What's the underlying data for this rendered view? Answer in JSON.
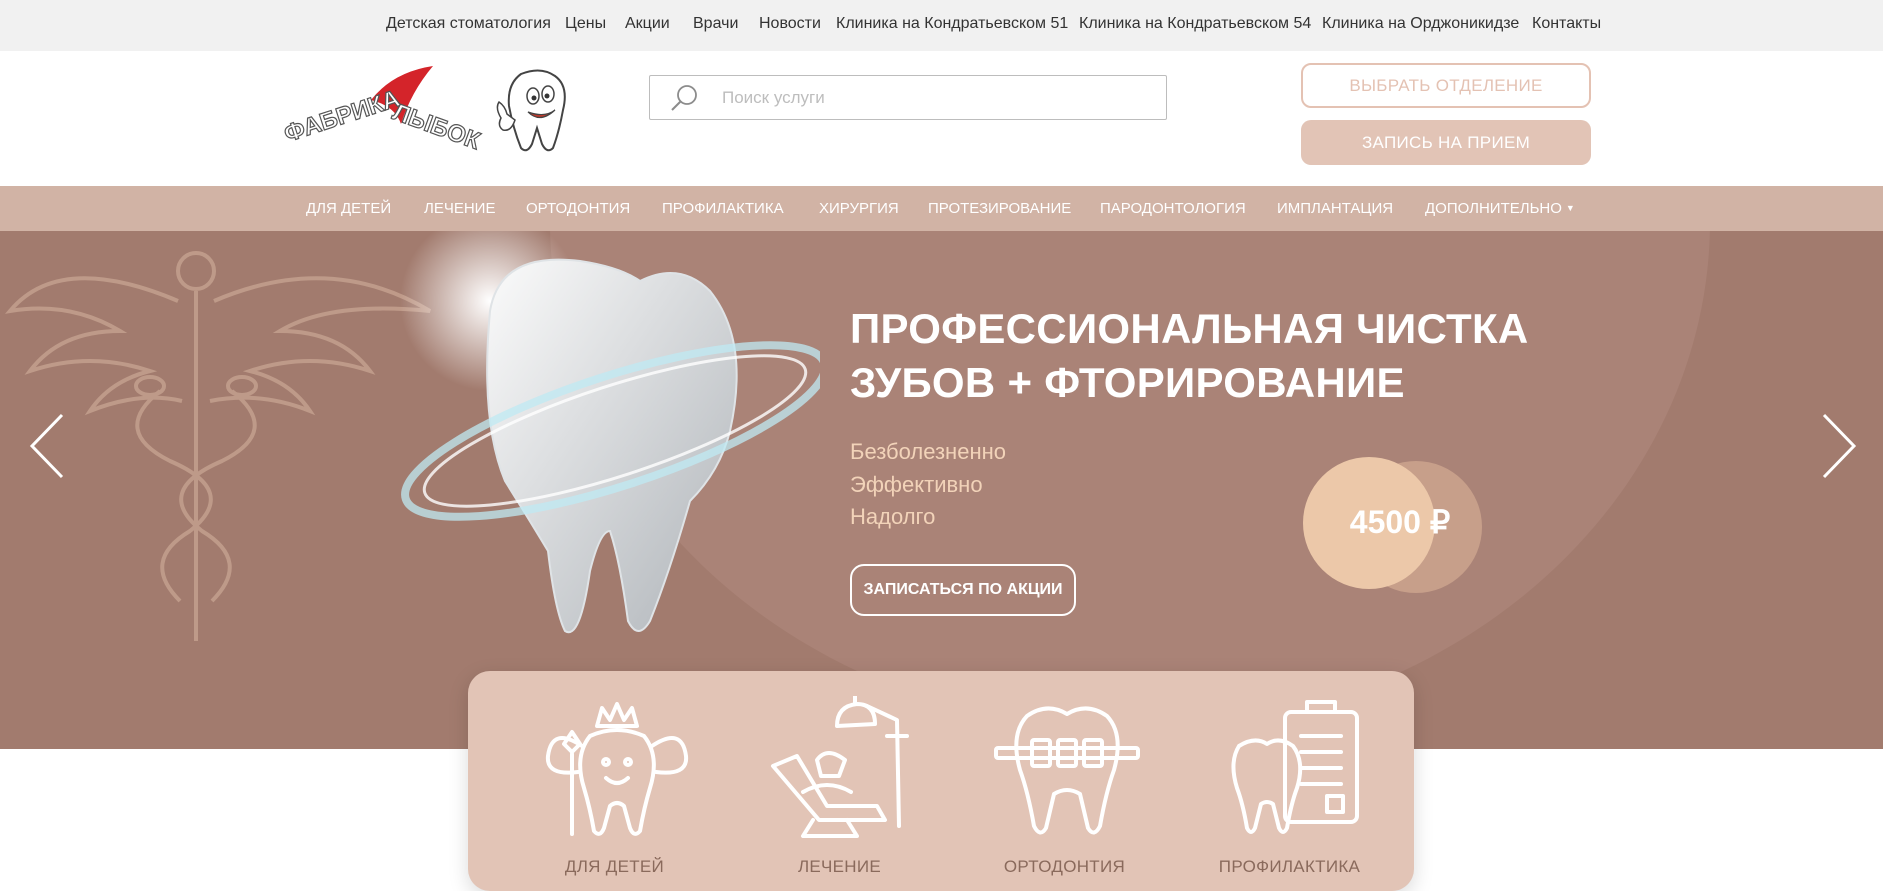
{
  "topnav": {
    "items": [
      {
        "label": "Детская стоматология"
      },
      {
        "label": "Цены"
      },
      {
        "label": "Акции"
      },
      {
        "label": "Врачи"
      },
      {
        "label": "Новости"
      },
      {
        "label": "Клиника на Кондратьевском 51"
      },
      {
        "label": "Клиника на Кондратьевском 54"
      },
      {
        "label": "Клиника на Орджоникидзе"
      },
      {
        "label": "Контакты"
      }
    ]
  },
  "header": {
    "logo": {
      "text_part1": "ФАБРИКА",
      "text_part2": "ЛЫБОК"
    },
    "search": {
      "placeholder": "Поиск услуги",
      "value": ""
    },
    "branch_button": "ВЫБРАТЬ ОТДЕЛЕНИЕ",
    "appointment_button": "ЗАПИСЬ НА ПРИЕМ"
  },
  "mainnav": {
    "items": [
      {
        "label": "ДЛЯ ДЕТЕЙ"
      },
      {
        "label": "ЛЕЧЕНИЕ"
      },
      {
        "label": "ОРТОДОНТИЯ"
      },
      {
        "label": "ПРОФИЛАКТИКА"
      },
      {
        "label": "ХИРУРГИЯ"
      },
      {
        "label": "ПРОТЕЗИРОВАНИЕ"
      },
      {
        "label": "ПАРОДОНТОЛОГИЯ"
      },
      {
        "label": "ИМПЛАНТАЦИЯ"
      },
      {
        "label": "ДОПОЛНИТЕЛЬНО"
      }
    ]
  },
  "hero": {
    "title_line1": "ПРОФЕССИОНАЛЬНАЯ ЧИСТКА",
    "title_line2": "ЗУБОВ + ФТОРИРОВАНИЕ",
    "features": [
      "Безболезненно",
      "Эффективно",
      "Надолго"
    ],
    "cta": "ЗАПИСАТЬСЯ ПО АКЦИИ",
    "price": "4500 ₽",
    "colors": {
      "background": "#a27b6e",
      "accent": "#f2d3b9"
    }
  },
  "services": [
    {
      "label": "ДЛЯ ДЕТЕЙ",
      "icon": "tooth-fairy-icon"
    },
    {
      "label": "ЛЕЧЕНИЕ",
      "icon": "dental-chair-icon"
    },
    {
      "label": "ОРТОДОНТИЯ",
      "icon": "tooth-braces-icon"
    },
    {
      "label": "ПРОФИЛАКТИКА",
      "icon": "tooth-checklist-icon"
    }
  ]
}
